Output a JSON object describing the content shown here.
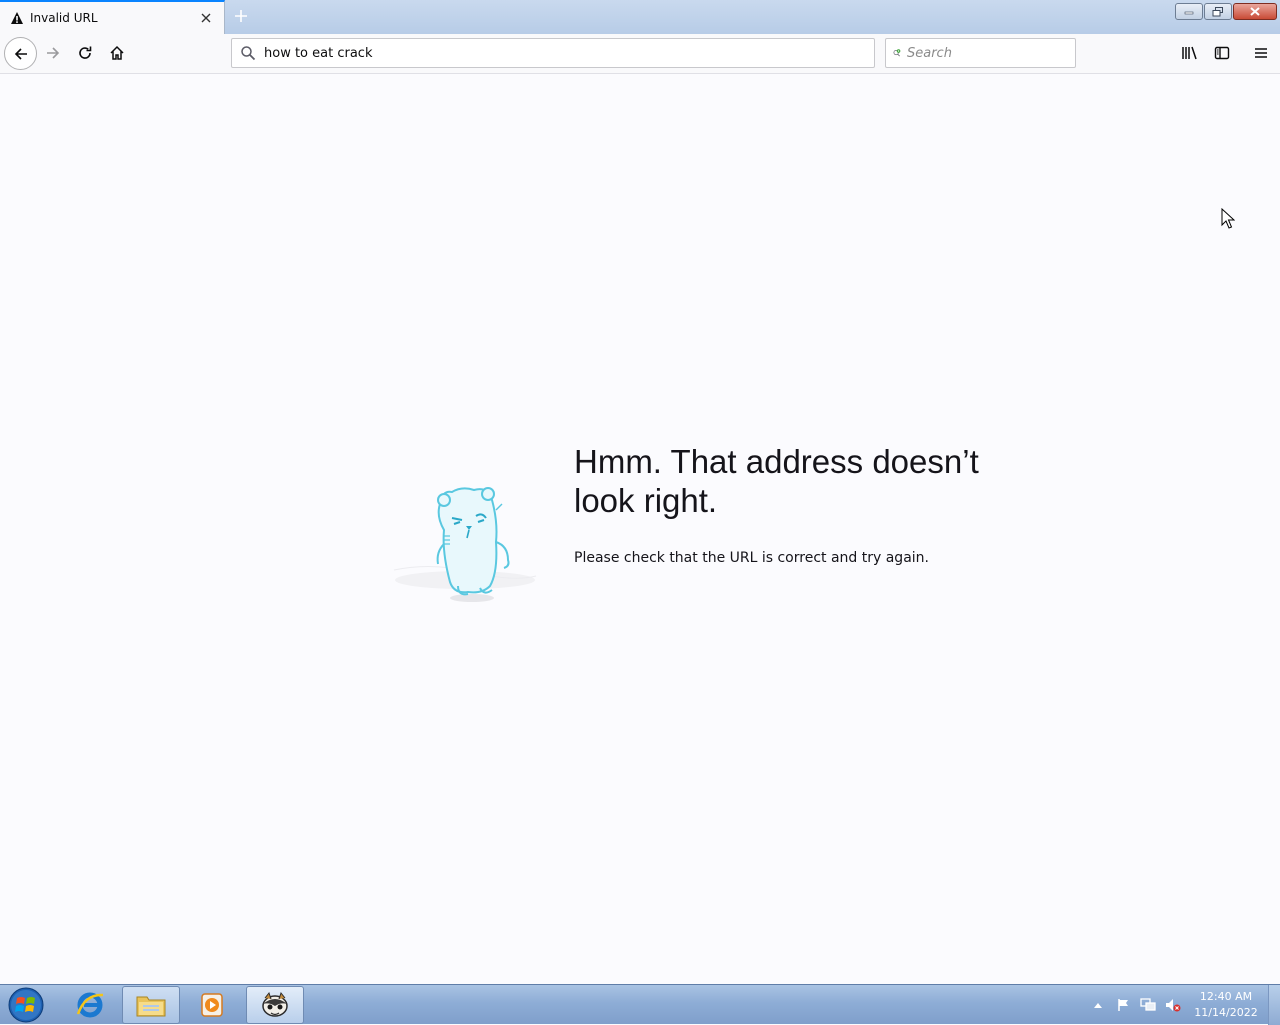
{
  "browser": {
    "tab": {
      "title": "Invalid URL",
      "icon": "warning-icon",
      "close_icon": "close-icon"
    },
    "new_tab_icon": "plus-icon",
    "window_controls": [
      "minimize-icon",
      "restore-icon",
      "close-icon"
    ],
    "urlbar": {
      "value": "how to eat crack",
      "icon": "search-icon"
    },
    "searchbar": {
      "placeholder": "Search",
      "icon": "search-engine-icon"
    },
    "toolbar_icons": [
      "back-arrow-icon",
      "forward-arrow-icon",
      "reload-icon",
      "home-icon",
      "library-icon",
      "sidebar-icon",
      "hamburger-menu-icon"
    ]
  },
  "error_page": {
    "title": "Hmm. That address doesn’t look right.",
    "description": "Please check that the URL is correct and try again.",
    "illustration": "confused-bear-illustration"
  },
  "taskbar": {
    "apps": [
      "windows-start-icon",
      "internet-explorer-icon",
      "file-explorer-icon",
      "media-player-icon",
      "firefox-app-icon"
    ],
    "tray_icons": [
      "tray-expand-icon",
      "action-center-flag-icon",
      "network-icon",
      "volume-muted-icon"
    ],
    "clock": {
      "time": "12:40 AM",
      "date": "11/14/2022"
    }
  },
  "colors": {
    "accent": "#0a84ff",
    "page_background": "#fbfbfe",
    "illustration": "#5ac8e0"
  }
}
